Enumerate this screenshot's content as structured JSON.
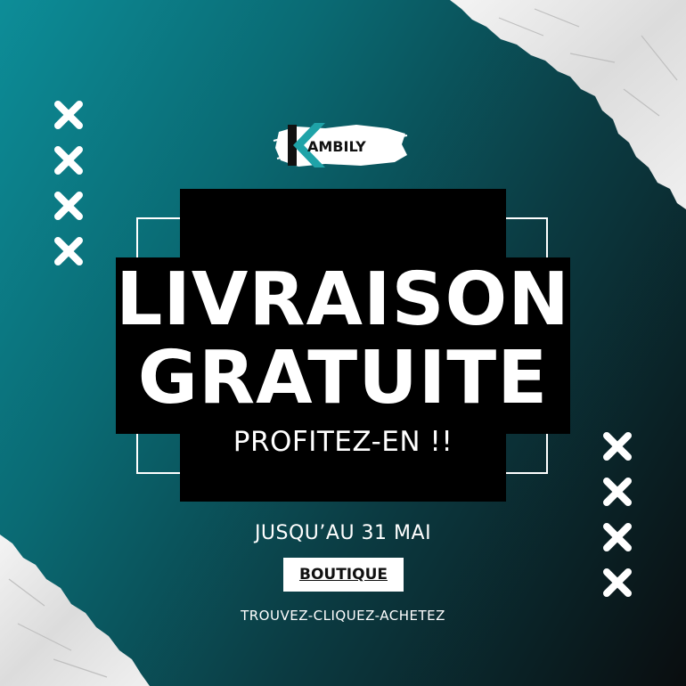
{
  "brand": {
    "logo_text": "AMBILY",
    "logo_icon": "k-chevron-logo"
  },
  "headline": {
    "line1": "LIVRAISON",
    "line2": "GRATUITE"
  },
  "subheadline": "PROFITEZ-EN !!",
  "offer_end": "JUSQU’AU 31 MAI",
  "cta": {
    "label": "BOUTIQUE"
  },
  "slogan": "TROUVEZ-CLIQUEZ-ACHETEZ",
  "decor": {
    "left_crosses": 4,
    "right_crosses": 4,
    "icon": "x-mark-icon"
  },
  "colors": {
    "background_start": "#0d8d98",
    "background_end": "#0a0d0f",
    "panel": "#000000",
    "text": "#ffffff",
    "accent": "#1fa3a8"
  }
}
